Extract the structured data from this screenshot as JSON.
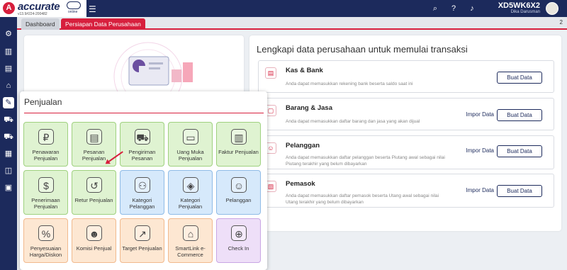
{
  "header": {
    "logo_text": "accurate",
    "logo_online": "online",
    "version": "v13.9#224-200482",
    "user_id": "XD5WK6X2",
    "user_name": "Dika Darusman"
  },
  "tabs": {
    "dashboard": "Dashboard",
    "active": "Persiapan Data Perusahaan",
    "count": "2"
  },
  "right_panel": {
    "title": "Lengkapi data perusahaan untuk memulai transaksi",
    "items": [
      {
        "title": "Kas & Bank",
        "desc": "Anda dapat memasukkan rekening bank beserta saldo saat ini",
        "import": "",
        "button": "Buat Data"
      },
      {
        "title": "Barang & Jasa",
        "desc": "Anda dapat memasukkan daftar barang dan jasa yang akan dijual",
        "import": "Impor Data",
        "button": "Buat Data"
      },
      {
        "title": "Pelanggan",
        "desc": "Anda dapat memasukkan daftar pelanggan beserta Piutang awal sebagai nilai Piutang terakhir yang belum dibayarkan",
        "import": "Impor Data",
        "button": "Buat Data"
      },
      {
        "title": "Pemasok",
        "desc": "Anda dapat memasukkan daftar pemasok beserta Utang awal sebagai nilai Utang terakhir yang belum dibayarkan",
        "import": "Impor Data",
        "button": "Buat Data"
      }
    ]
  },
  "popup": {
    "title": "Penjualan",
    "tiles": [
      {
        "label": "Penawaran Penjualan",
        "icon": "quote-icon",
        "color": "green"
      },
      {
        "label": "Pesanan Penjualan",
        "icon": "order-icon",
        "color": "green"
      },
      {
        "label": "Pengiriman Pesanan",
        "icon": "delivery-icon",
        "color": "green"
      },
      {
        "label": "Uang Muka Penjualan",
        "icon": "down-payment-icon",
        "color": "green"
      },
      {
        "label": "Faktur Penjualan",
        "icon": "invoice-icon",
        "color": "green"
      },
      {
        "label": "Penerimaan Penjualan",
        "icon": "receipt-icon",
        "color": "green"
      },
      {
        "label": "Retur Penjualan",
        "icon": "return-icon",
        "color": "green"
      },
      {
        "label": "Kategori Pelanggan",
        "icon": "customer-category-icon",
        "color": "blue"
      },
      {
        "label": "Kategori Penjualan",
        "icon": "sales-category-icon",
        "color": "blue"
      },
      {
        "label": "Pelanggan",
        "icon": "customer-icon",
        "color": "blue"
      },
      {
        "label": "Penyesuaian Harga/Diskon",
        "icon": "price-adjust-icon",
        "color": "orange"
      },
      {
        "label": "Komisi Penjual",
        "icon": "commission-icon",
        "color": "orange"
      },
      {
        "label": "Target Penjualan",
        "icon": "target-icon",
        "color": "orange"
      },
      {
        "label": "SmartLink e-Commerce",
        "icon": "store-icon",
        "color": "orange"
      },
      {
        "label": "Check In",
        "icon": "check-in-icon",
        "color": "purple"
      }
    ]
  },
  "colors": {
    "brand_red": "#d71f3d",
    "navy": "#1c2a5c"
  }
}
